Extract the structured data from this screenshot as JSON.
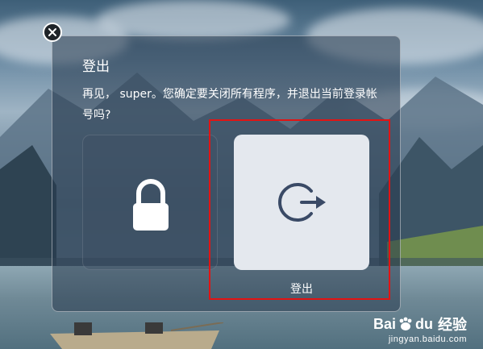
{
  "dialog": {
    "title": "登出",
    "message": "再见， super。您确定要关闭所有程序，并退出当前登录帐号吗?",
    "options": [
      {
        "id": "lock",
        "label": "",
        "icon": "lock-icon",
        "selected": false
      },
      {
        "id": "logout",
        "label": "登出",
        "icon": "logout-icon",
        "selected": true
      }
    ],
    "close_icon": "close-icon"
  },
  "watermark": {
    "brand_part1": "Bai",
    "brand_part2": "du",
    "brand_cn": "经验",
    "url": "jingyan.baidu.com"
  },
  "colors": {
    "highlight_box": "#e31313",
    "selected_tile": "#e4e8ee",
    "icon_dark": "#3a4a66"
  }
}
